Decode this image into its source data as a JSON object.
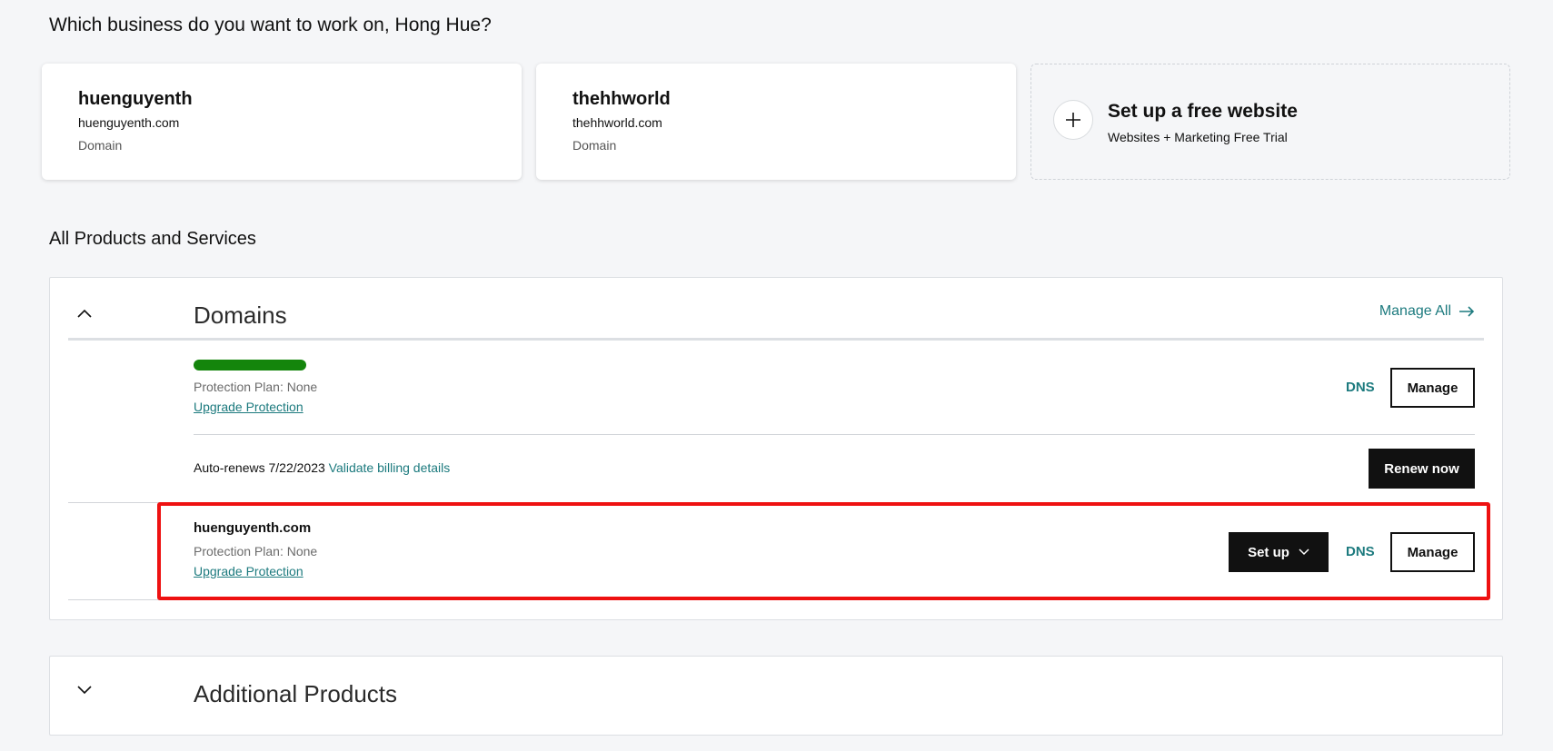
{
  "greeting": "Which business do you want to work on, Hong Hue?",
  "businesses": [
    {
      "name": "huenguyenth",
      "domain": "huenguyenth.com",
      "type": "Domain"
    },
    {
      "name": "thehhworld",
      "domain": "thehhworld.com",
      "type": "Domain"
    }
  ],
  "setup_card": {
    "icon": "plus-icon",
    "title": "Set up a free website",
    "subtitle": "Websites + Marketing Free Trial"
  },
  "section_title": "All Products and Services",
  "domains_panel": {
    "title": "Domains",
    "manage_all": "Manage All",
    "items": [
      {
        "name_redacted": true,
        "protection": "Protection Plan: None",
        "upgrade": "Upgrade Protection",
        "dns": "DNS",
        "manage": "Manage",
        "renew_date": "Auto-renews 7/22/2023",
        "validate": "Validate billing details",
        "renew_now": "Renew now"
      },
      {
        "name": "huenguyenth.com",
        "protection": "Protection Plan: None",
        "upgrade": "Upgrade Protection",
        "setup": "Set up",
        "dns": "DNS",
        "manage": "Manage"
      }
    ]
  },
  "additional_panel": {
    "title": "Additional Products"
  },
  "colors": {
    "teal_link": "#1c7a7e",
    "highlight": "#ee1111",
    "redaction": "#14850c"
  }
}
